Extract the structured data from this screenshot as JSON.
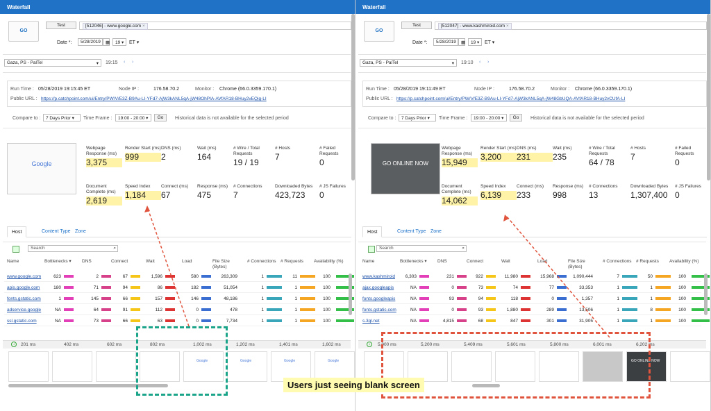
{
  "panels": [
    {
      "title": "Waterfall",
      "go": "GO",
      "test": "Test",
      "target": "[512046] - www.google.com",
      "date_label": "Date *:",
      "date": "5/28/2019",
      "day": "19",
      "tz": "ET",
      "location": "Gaza, PS - PalTel",
      "time": "19:15",
      "run_time_label": "Run Time :",
      "run_time": "05/28/2019 19:15:45 ET",
      "node_label": "Node IP :",
      "node_ip": "176.58.70.2",
      "monitor_label": "Monitor :",
      "monitor": "Chrome (66.0.3359.170.1)",
      "public_label": "Public URL :",
      "public_url": "https://p.catchpoint.com/ui/Entry/PW/V/E3Z-B9Au-LI-YFd7-AjW3kANL5qA-jW48OhPIA-AVfAR18-BHuy2vEQjg-LI",
      "compare_label": "Compare to :",
      "compare": "7 Days Prior",
      "timeframe_label": "Time Frame :",
      "timeframe": "19:00 - 20:00",
      "go2": "Go",
      "hist": "Historical data is not available for the selected period",
      "thumb_text": "Google",
      "metrics": [
        {
          "label": "Webpage Response (ms)",
          "value": "3,375",
          "hl": true
        },
        {
          "label": "Render Start (ms)",
          "value": "999",
          "hl": true
        },
        {
          "label": "DNS (ms)",
          "value": "2",
          "hl": false
        },
        {
          "label": "Wait (ms)",
          "value": "164",
          "hl": false
        },
        {
          "label": "# Wire / Total Requests",
          "value": "19 / 19",
          "hl": false
        },
        {
          "label": "# Hosts",
          "value": "7",
          "hl": false
        },
        {
          "label": "# Failed Requests",
          "value": "0",
          "hl": false
        },
        {
          "label": "Document Complete (ms)",
          "value": "2,619",
          "hl": true
        },
        {
          "label": "Speed Index",
          "value": "1,184",
          "hl": true
        },
        {
          "label": "Connect (ms)",
          "value": "67",
          "hl": false
        },
        {
          "label": "Response (ms)",
          "value": "475",
          "hl": false
        },
        {
          "label": "# Connections",
          "value": "7",
          "hl": false
        },
        {
          "label": "Downloaded Bytes",
          "value": "423,723",
          "hl": false
        },
        {
          "label": "# JS Failures",
          "value": "0",
          "hl": false
        }
      ],
      "tabs": [
        "Host",
        "Content Type",
        "Zone"
      ],
      "search": "Search",
      "headers": [
        "Name",
        "Bottlenecks ▾",
        "DNS",
        "Connect",
        "Wait",
        "Load",
        "File Size (Bytes)",
        "# Connections",
        "# Requests",
        "Availability (%)"
      ],
      "rows": [
        [
          "www.google.com",
          "623",
          "2",
          "67",
          "1,596",
          "580",
          "263,309",
          "1",
          "11",
          "100"
        ],
        [
          "apis.google.com",
          "180",
          "71",
          "94",
          "86",
          "182",
          "51,054",
          "1",
          "1",
          "100"
        ],
        [
          "fonts.gstatic.com",
          "1",
          "145",
          "66",
          "157",
          "146",
          "48,186",
          "1",
          "1",
          "100"
        ],
        [
          "adservice.google",
          "NA",
          "64",
          "91",
          "112",
          "0",
          "478",
          "1",
          "1",
          "100"
        ],
        [
          "ssl.gstatic.com",
          "NA",
          "73",
          "66",
          "63",
          "0",
          "7,734",
          "1",
          "1",
          "100"
        ]
      ],
      "ticks": [
        "201 ms",
        "402 ms",
        "602 ms",
        "802 ms",
        "1,002 ms",
        "1,202 ms",
        "1,401 ms",
        "1,602 ms"
      ]
    },
    {
      "title": "Waterfall",
      "go": "GO",
      "test": "Test",
      "target": "[512047] - www.kashmiroid.com",
      "date_label": "Date *:",
      "date": "5/28/2019",
      "day": "19",
      "tz": "ET",
      "location": "Gaza, PS - PalTel",
      "time": "19:10",
      "run_time_label": "Run Time :",
      "run_time": "05/28/2019 19:11:49 ET",
      "node_label": "Node IP :",
      "node_ip": "176.58.70.2",
      "monitor_label": "Monitor :",
      "monitor": "Chrome (66.0.3359.170.1)",
      "public_label": "Public URL :",
      "public_url": "https://p.catchpoint.com/ui/Entry/PW/V/E3Z-B9Au-LI-YFd7-AjW3kANL5qA-jW48GbUQA-AVfAR18-BHuy2vCUfA-LI",
      "compare_label": "Compare to :",
      "compare": "7 Days Prior",
      "timeframe_label": "Time Frame :",
      "timeframe": "19:00 - 20:00",
      "go2": "Go",
      "hist": "Historical data is not available for the selected period",
      "thumb_text": "GO ONLINE NOW",
      "metrics": [
        {
          "label": "Webpage Response (ms)",
          "value": "15,949",
          "hl": true
        },
        {
          "label": "Render Start (ms)",
          "value": "3,200",
          "hl": true
        },
        {
          "label": "DNS (ms)",
          "value": "231",
          "hl": true
        },
        {
          "label": "Wait (ms)",
          "value": "235",
          "hl": false
        },
        {
          "label": "# Wire / Total Requests",
          "value": "64 / 78",
          "hl": false
        },
        {
          "label": "# Hosts",
          "value": "7",
          "hl": false
        },
        {
          "label": "# Failed Requests",
          "value": "0",
          "hl": false
        },
        {
          "label": "Document Complete (ms)",
          "value": "14,062",
          "hl": true
        },
        {
          "label": "Speed Index",
          "value": "6,139",
          "hl": true
        },
        {
          "label": "Connect (ms)",
          "value": "233",
          "hl": false
        },
        {
          "label": "Response (ms)",
          "value": "998",
          "hl": false
        },
        {
          "label": "# Connections",
          "value": "13",
          "hl": false
        },
        {
          "label": "Downloaded Bytes",
          "value": "1,307,400",
          "hl": false
        },
        {
          "label": "# JS Failures",
          "value": "0",
          "hl": false
        }
      ],
      "tabs": [
        "Host",
        "Content Type",
        "Zone"
      ],
      "search": "Search",
      "headers": [
        "Name",
        "Bottlenecks ▾",
        "DNS",
        "Connect",
        "Wait",
        "Load",
        "File Size (Bytes)",
        "# Connections",
        "# Requests",
        "Availability (%)"
      ],
      "rows": [
        [
          "www.kashmiroid",
          "6,303",
          "231",
          "922",
          "11,980",
          "15,968",
          "1,090,444",
          "7",
          "50",
          "100"
        ],
        [
          "ajax.googleapis",
          "NA",
          "0",
          "73",
          "74",
          "77",
          "33,353",
          "1",
          "1",
          "100"
        ],
        [
          "fonts.googleapis",
          "NA",
          "93",
          "94",
          "118",
          "0",
          "1,357",
          "1",
          "1",
          "100"
        ],
        [
          "fonts.gstatic.com",
          "NA",
          "0",
          "93",
          "1,880",
          "289",
          "13,506",
          "1",
          "8",
          "100"
        ],
        [
          "s.3gl.net",
          "NA",
          "4,815",
          "68",
          "847",
          "301",
          "31,905",
          "1",
          "1",
          "100"
        ]
      ],
      "ticks": [
        "5,000 ms",
        "5,200 ms",
        "5,409 ms",
        "5,601 ms",
        "5,800 ms",
        "6,001 ms",
        "6,202 ms"
      ]
    }
  ],
  "annotation": "Users just seeing blank screen",
  "colors": {
    "header": "#1f72c6",
    "highlight": "#fff3a8",
    "left_dash": "#1aa58a",
    "right_dash": "#e0533c"
  }
}
